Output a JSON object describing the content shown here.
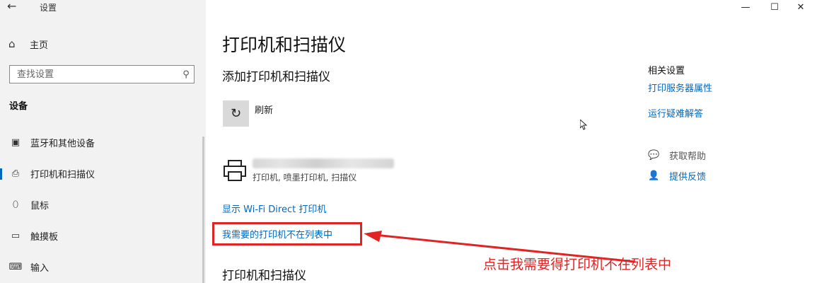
{
  "app": {
    "title": "设置",
    "back_glyph": "←"
  },
  "window_controls": {
    "minimize": "—",
    "maximize": "☐",
    "close": "✕"
  },
  "sidebar": {
    "home_label": "主页",
    "search_placeholder": "查找设置",
    "section_title": "设备",
    "items": [
      {
        "label": "蓝牙和其他设备",
        "icon": "bluetooth-devices-icon"
      },
      {
        "label": "打印机和扫描仪",
        "icon": "printer-icon",
        "active": true
      },
      {
        "label": "鼠标",
        "icon": "mouse-icon"
      },
      {
        "label": "触摸板",
        "icon": "touchpad-icon"
      },
      {
        "label": "输入",
        "icon": "keyboard-icon"
      }
    ]
  },
  "main": {
    "title": "打印机和扫描仪",
    "add_section": "添加打印机和扫描仪",
    "refresh_label": "刷新",
    "printer_status": "打印机, 喷墨打印机, 扫描仪",
    "wifi_direct_link": "显示 Wi-Fi Direct 打印机",
    "not_listed_link": "我需要的打印机不在列表中",
    "printers_section": "打印机和扫描仪"
  },
  "related": {
    "title": "相关设置",
    "link_print_server": "打印服务器属性",
    "link_troubleshoot": "运行疑难解答",
    "get_help": "获取帮助",
    "give_feedback": "提供反馈"
  },
  "annotation": {
    "text": "点击我需要得打印机不在列表中",
    "color": "#e02424"
  },
  "colors": {
    "accent": "#0067c0",
    "sidebar_bg": "#f2f2f2"
  }
}
